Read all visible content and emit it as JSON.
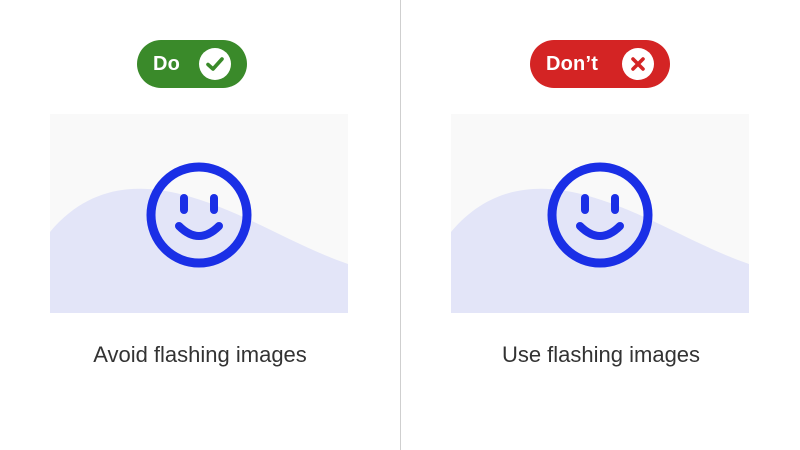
{
  "do": {
    "badge_label": "Do",
    "badge_color": "#3a8a2a",
    "badge_icon": "checkmark-icon",
    "caption": "Avoid flashing images",
    "illustration_icon": "smiley-face-icon"
  },
  "dont": {
    "badge_label": "Don’t",
    "badge_color": "#d42424",
    "badge_icon": "close-x-icon",
    "caption": "Use flashing images",
    "illustration_icon": "smiley-face-icon"
  },
  "colors": {
    "smiley": "#1a2fe6",
    "hill": "#e3e5f8",
    "illustration_background": "#f9f9f9",
    "divider": "#cfcfcf",
    "caption_text": "#333333"
  }
}
